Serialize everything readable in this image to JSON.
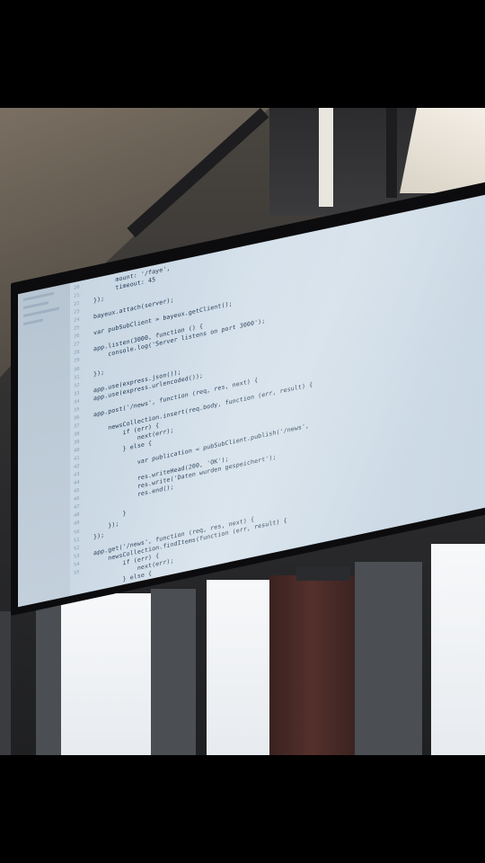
{
  "scene": {
    "subject": "wall-mounted-monitor",
    "colors": {
      "screen": "#cdd9e4",
      "code_text": "#1f3550",
      "keyword": "#2b4fa8",
      "bezel": "#0c0c0e",
      "letterbox": "#000000"
    }
  },
  "editor": {
    "line_numbers": [
      "20",
      "21",
      "22",
      "23",
      "24",
      "25",
      "26",
      "27",
      "28",
      "29",
      "30",
      "31",
      "32",
      "33",
      "34",
      "35",
      "36",
      "37",
      "38",
      "39",
      "40",
      "41",
      "42",
      "43",
      "44",
      "45",
      "46",
      "47",
      "48",
      "49",
      "50",
      "51",
      "52",
      "53",
      "54",
      "55"
    ],
    "lines": [
      "      mount: '/faye',",
      "      timeout: 45",
      "});",
      "",
      "bayeux.attach(server);",
      "",
      "var pubSubClient = bayeux.getClient();",
      "",
      "app.listen(3000, function () {",
      "    console.log('Server listens on port 3000');",
      "",
      "});",
      "",
      "app.use(express.json());",
      "app.use(express.urlencoded());",
      "",
      "app.post('/news', function (req, res, next) {",
      "",
      "    newsCollection.insert(req.body, function (err, result) {",
      "        if (err) {",
      "            next(err);",
      "        } else {",
      "",
      "            var publication = pubSubClient.publish('/news',",
      "",
      "            res.writeHead(200, 'OK');",
      "            res.write('Daten wurden gespeichert');",
      "            res.end();",
      "",
      "        }",
      "    });",
      "});",
      "",
      "app.get('/news', function (req, res, next) {",
      "    newsCollection.findItems(function (err, result) {",
      "        if (err) {",
      "            next(err);",
      "        } else {"
    ]
  }
}
